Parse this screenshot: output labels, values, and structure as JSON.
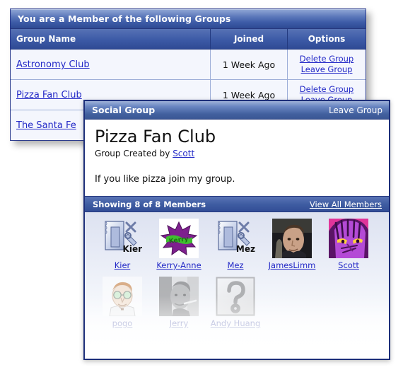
{
  "groups_panel": {
    "title": "You are a Member of the following Groups",
    "columns": {
      "name": "Group Name",
      "joined": "Joined",
      "options": "Options"
    },
    "option_labels": {
      "delete": "Delete Group",
      "leave": "Leave Group"
    },
    "rows": [
      {
        "name": "Astronomy Club",
        "joined": "1 Week Ago",
        "delete": "Delete Group",
        "leave": "Leave Group"
      },
      {
        "name": "Pizza Fan Club",
        "joined": "1 Week Ago",
        "delete": "Delete Group",
        "leave": "Leave Group"
      },
      {
        "name": "The Santa Fe",
        "joined": "",
        "delete": "",
        "leave": ""
      }
    ]
  },
  "dialog": {
    "titlebar": {
      "title": "Social Group",
      "leave_group": "Leave Group"
    },
    "group_name": "Pizza Fan Club",
    "created_by_prefix": "Group Created by ",
    "creator": "Scott",
    "description": "If you like pizza join my group.",
    "members_bar": {
      "count_label": "Showing 8 of 8 Members",
      "view_all": "View All Members"
    },
    "members": [
      {
        "name": "Kier",
        "avatar": "broken-image-icon",
        "avatar_label": "Kier"
      },
      {
        "name": "Kerry-Anne",
        "avatar": "starburst-graphic-avatar",
        "avatar_label": ""
      },
      {
        "name": "Mez",
        "avatar": "broken-image-icon",
        "avatar_label": "Mez"
      },
      {
        "name": "JamesLimm",
        "avatar": "photo-portrait-avatar",
        "avatar_label": ""
      },
      {
        "name": "Scott",
        "avatar": "anime-face-avatar",
        "avatar_label": ""
      },
      {
        "name": "pogo",
        "avatar": "cartoon-face-avatar",
        "avatar_label": ""
      },
      {
        "name": "Jerry",
        "avatar": "grayscale-photo-avatar",
        "avatar_label": ""
      },
      {
        "name": "Andy Huang",
        "avatar": "question-mark-placeholder-icon",
        "avatar_label": ""
      }
    ]
  },
  "colors": {
    "header_blue": "#3c5aa6",
    "link_blue": "#2329c7",
    "panel_bg": "#f4f6fd",
    "joined_cell_bg": "#e2e7f4",
    "border_blue": "#2a3a8c"
  }
}
